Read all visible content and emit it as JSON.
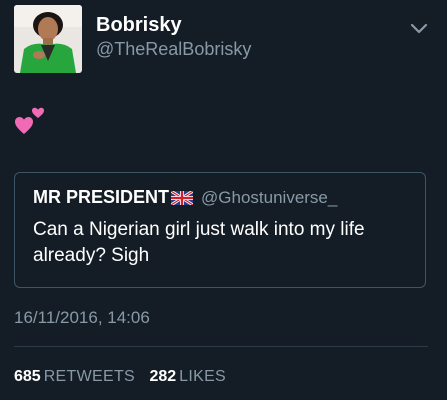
{
  "author": {
    "display_name": "Bobrisky",
    "handle": "@TheRealBobrisky",
    "avatar_icon": "profile-photo"
  },
  "menu": {
    "icon": "chevron-down-icon"
  },
  "tweet": {
    "emoji_icon": "two-hearts-emoji"
  },
  "quote": {
    "name": "MR PRESIDENT",
    "flag_icon": "uk-flag-emoji",
    "handle": "@Ghostuniverse_",
    "text": "Can a Nigerian girl just walk into my life already? Sigh"
  },
  "timestamp": "16/11/2016, 14:06",
  "stats": {
    "retweets_count": "685",
    "retweets_label": "RETWEETS",
    "likes_count": "282",
    "likes_label": "LIKES"
  },
  "colors": {
    "background": "#141d26",
    "primary_text": "#ffffff",
    "secondary_text": "#8899a6",
    "border": "#3d5466",
    "heart_pink": "#f06ab6"
  }
}
